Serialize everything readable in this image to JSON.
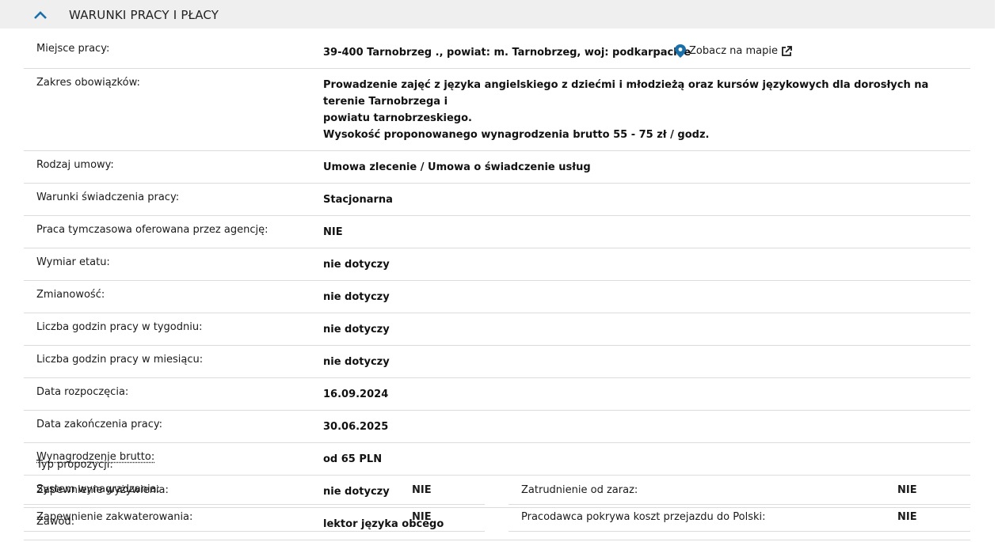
{
  "header": {
    "title": "WARUNKI PRACY I PŁACY"
  },
  "place": {
    "label": "Miejsce pracy:",
    "value": "39-400 Tarnobrzeg ., powiat: m. Tarnobrzeg, woj: podkarpackie",
    "map_link": "Zobacz na mapie"
  },
  "duties": {
    "label": "Zakres obowiązków:",
    "line1": "Prowadzenie zajęć z języka angielskiego z dziećmi i młodzieżą oraz kursów językowych dla dorosłych na terenie Tarnobrzega i",
    "line2": "powiatu tarnobrzeskiego.",
    "line3": "Wysokość proponowanego wynagrodzenia brutto 55 - 75 zł / godz."
  },
  "rows": [
    {
      "label": "Rodzaj umowy:",
      "value": "Umowa zlecenie / Umowa o świadczenie usług"
    },
    {
      "label": "Warunki świadczenia pracy:",
      "value": "Stacjonarna"
    },
    {
      "label": "Praca tymczasowa oferowana przez agencję:",
      "value": "NIE"
    },
    {
      "label": "Wymiar etatu:",
      "value": "nie dotyczy"
    },
    {
      "label": "Zmianowość:",
      "value": "nie dotyczy"
    },
    {
      "label": "Liczba godzin pracy w tygodniu:",
      "value": "nie dotyczy"
    },
    {
      "label": "Liczba godzin pracy w miesiącu:",
      "value": "nie dotyczy"
    },
    {
      "label": "Data rozpoczęcia:",
      "value": "16.09.2024"
    },
    {
      "label": "Data zakończenia pracy:",
      "value": "30.06.2025"
    },
    {
      "label": "Wynagrodzenie brutto:",
      "value": "od 65 PLN"
    },
    {
      "label": "System wynagradzania:",
      "value": "nie dotyczy"
    },
    {
      "label": "Zawód:",
      "value": "lektor języka obcego"
    }
  ],
  "typ": {
    "label": "Typ propozycji:"
  },
  "offer": {
    "food_label": "Zapewnienie wyżywienia:",
    "food_value": "NIE",
    "housing_label": "Zapewnienie zakwaterowania:",
    "housing_value": "NIE",
    "immediate_label": "Zatrudnienie od zaraz:",
    "immediate_value": "NIE",
    "travel_label": "Pracodawca pokrywa koszt przejazdu do Polski:",
    "travel_value": "NIE"
  },
  "colors": {
    "accent": "#1a6fa8",
    "border": "#dcdcdc",
    "header_bg": "#efefef"
  }
}
